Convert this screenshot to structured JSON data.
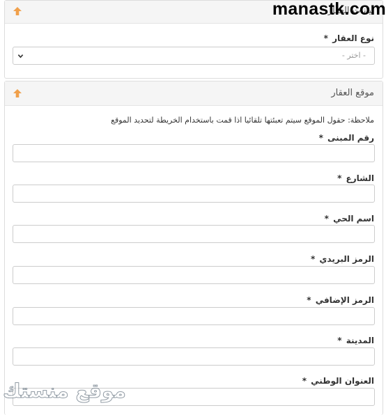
{
  "watermark": {
    "text": "manastk.com"
  },
  "bottom_watermark": {
    "text": "موقع منستك"
  },
  "panel_top": {
    "title": "بيانات العقار",
    "field": {
      "label": "نوع العقار",
      "required_mark": "*",
      "selected": "- اختر -"
    }
  },
  "panel_location": {
    "title": "موقع العقار",
    "note": "ملاحظة: حقول الموقع سيتم تعبئتها تلقائيا اذا قمت باستخدام الخريطة لتحديد الموقع",
    "fields": [
      {
        "label": "رقم المبنى",
        "required_mark": "*",
        "value": ""
      },
      {
        "label": "الشارع",
        "required_mark": "*",
        "value": ""
      },
      {
        "label": "اسم الحي",
        "required_mark": "*",
        "value": ""
      },
      {
        "label": "الرمز البريدي",
        "required_mark": "*",
        "value": ""
      },
      {
        "label": "الرمز الإضافي",
        "required_mark": "*",
        "value": ""
      },
      {
        "label": "المدينة",
        "required_mark": "*",
        "value": ""
      },
      {
        "label": "العنوان الوطني",
        "required_mark": "*",
        "value": ""
      }
    ]
  },
  "colors": {
    "accent_arrow": "#f0a04b",
    "border": "#cccccc",
    "header_bg": "#f5f5f5"
  },
  "icons": {
    "collapse": "arrow-up-icon",
    "dropdown": "chevron-down-icon"
  }
}
